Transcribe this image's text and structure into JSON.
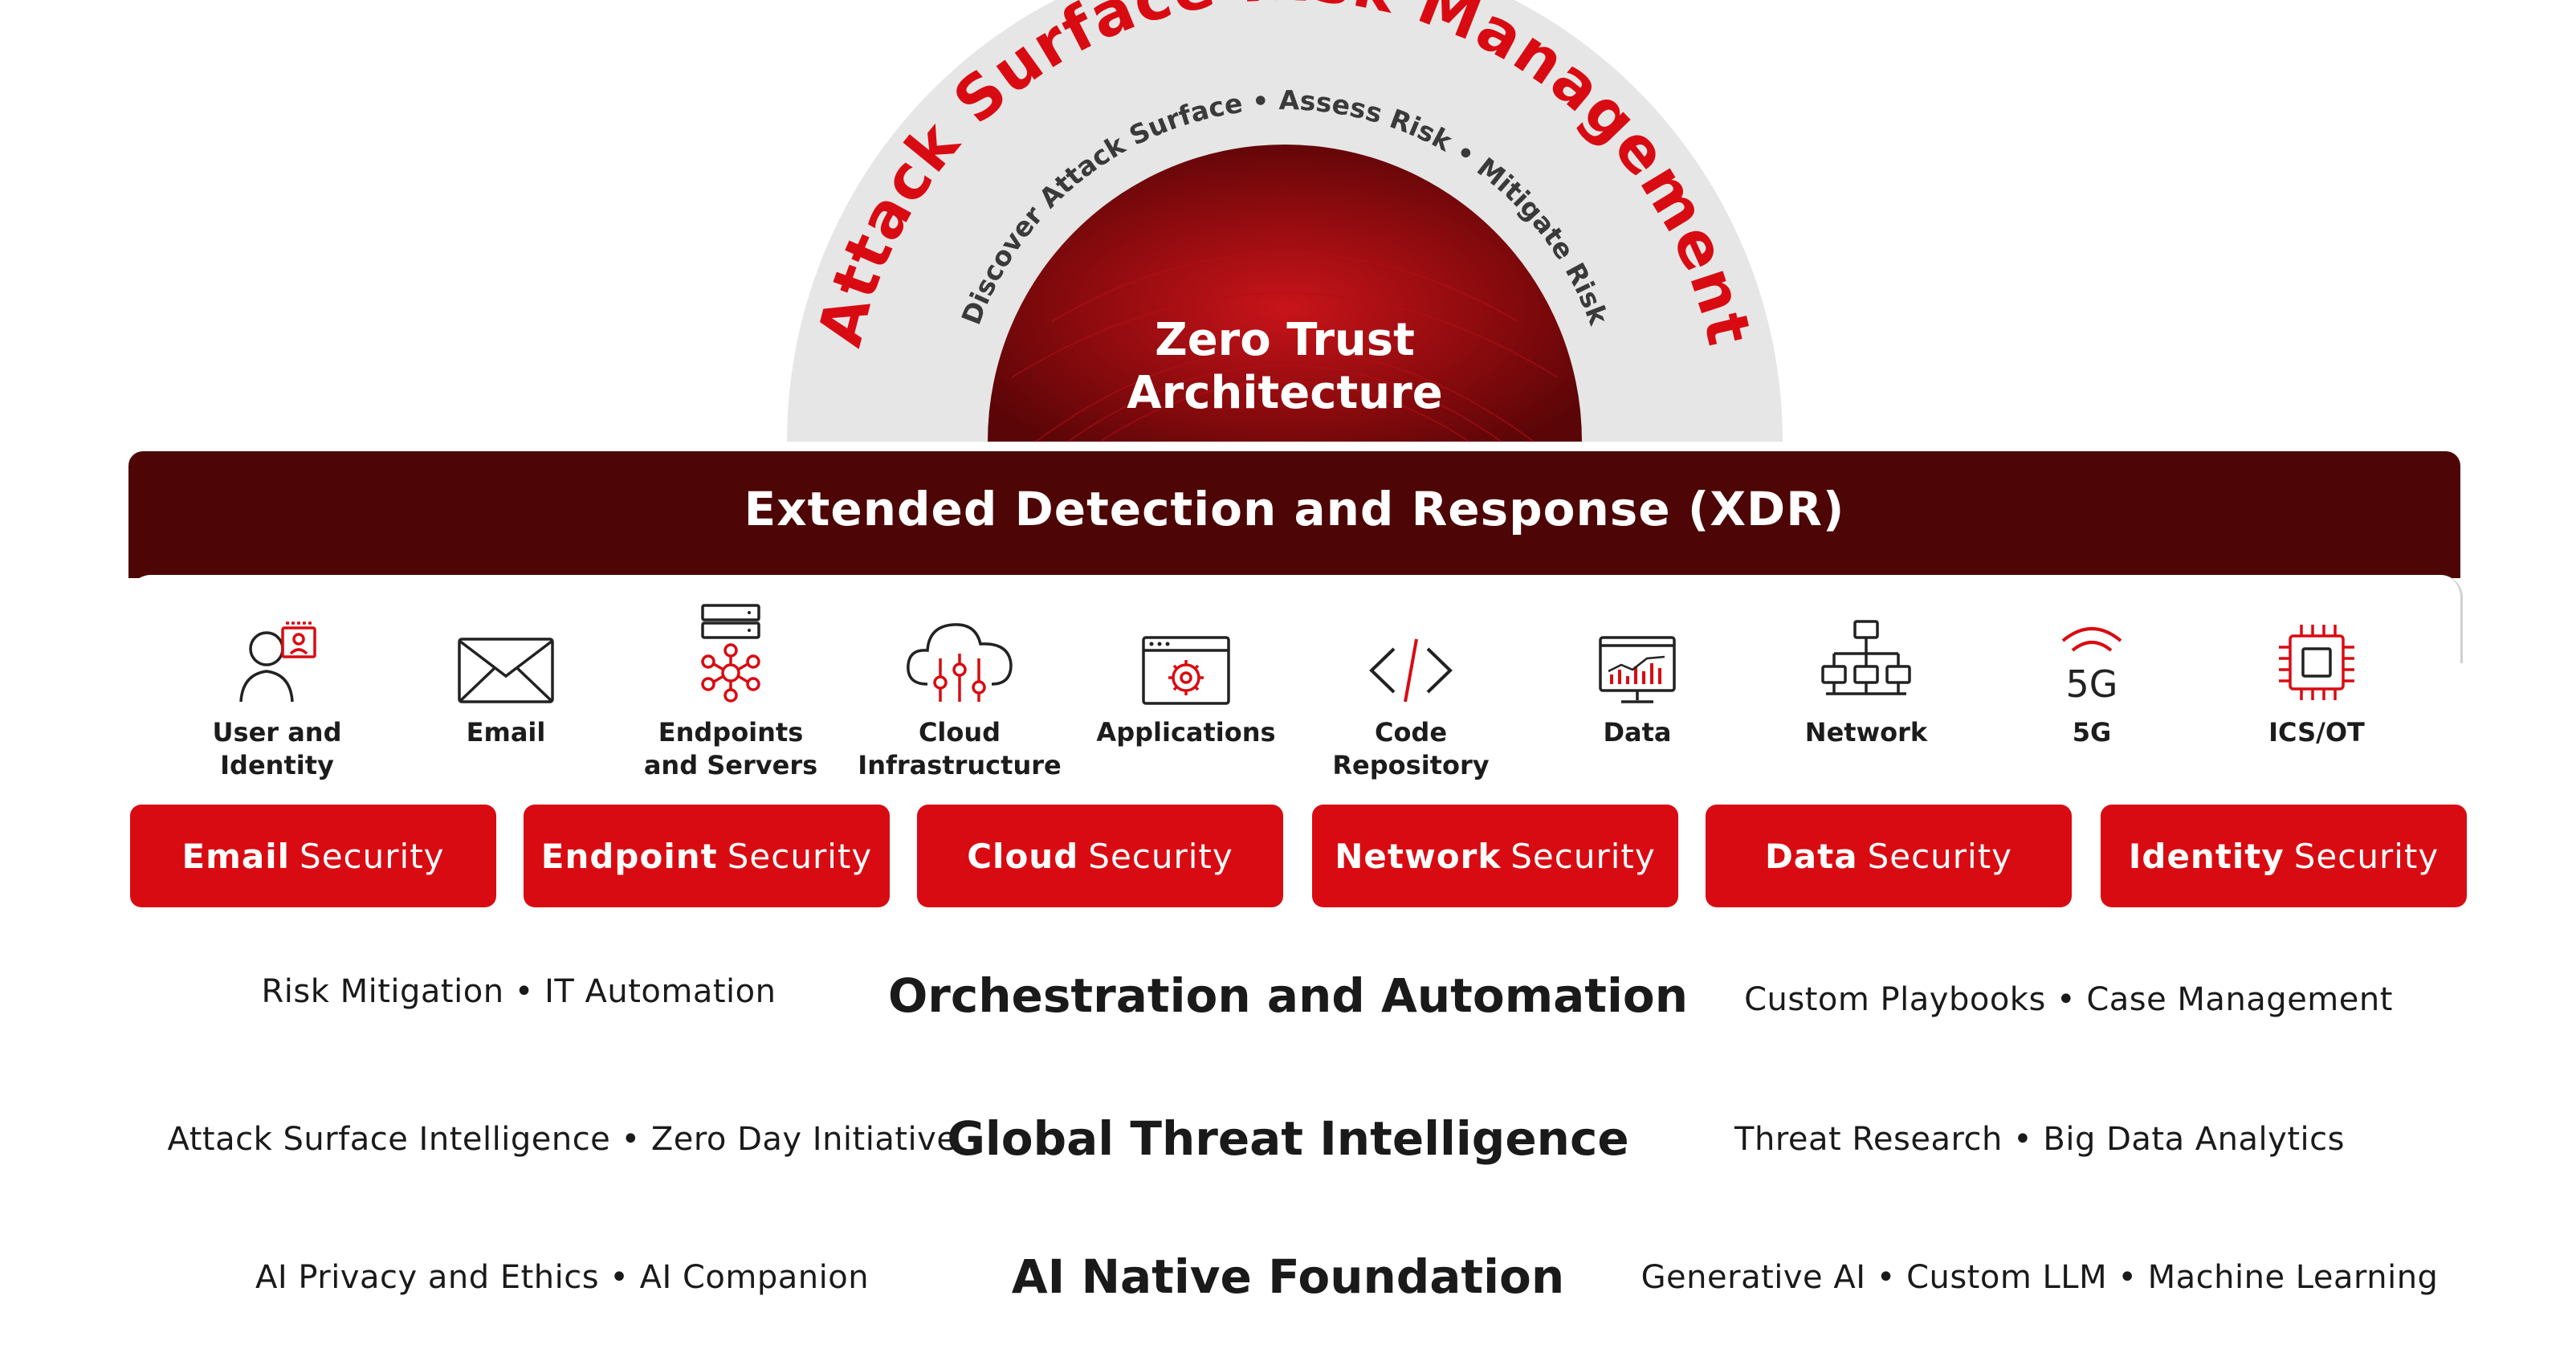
{
  "colors": {
    "red": "#d90b12",
    "dark_red": "#4d0505",
    "grey_arc": "#e6e6e6",
    "text": "#1a1a1a"
  },
  "arc": {
    "title": "Attack Surface Risk Management",
    "steps": [
      "Discover Attack Surface",
      "Assess Risk",
      "Mitigate Risk"
    ]
  },
  "zero_trust": {
    "line1": "Zero Trust",
    "line2": "Architecture"
  },
  "xdr": {
    "title": "Extended Detection and Response (XDR)"
  },
  "assets": [
    {
      "icon": "user-identity-icon",
      "line1": "User and",
      "line2": "Identity"
    },
    {
      "icon": "email-icon",
      "line1": "Email",
      "line2": ""
    },
    {
      "icon": "servers-icon",
      "line1": "Endpoints",
      "line2": "and Servers"
    },
    {
      "icon": "cloud-icon",
      "line1": "Cloud",
      "line2": "Infrastructure"
    },
    {
      "icon": "applications-icon",
      "line1": "Applications",
      "line2": ""
    },
    {
      "icon": "code-icon",
      "line1": "Code",
      "line2": "Repository"
    },
    {
      "icon": "data-icon",
      "line1": "Data",
      "line2": ""
    },
    {
      "icon": "network-icon",
      "line1": "Network",
      "line2": ""
    },
    {
      "icon": "fiveg-icon",
      "line1": "5G",
      "line2": "",
      "icon_text": "5G"
    },
    {
      "icon": "chip-icon",
      "line1": "ICS/OT",
      "line2": ""
    }
  ],
  "security": [
    {
      "bold": "Email",
      "rest": "Security"
    },
    {
      "bold": "Endpoint",
      "rest": "Security"
    },
    {
      "bold": "Cloud",
      "rest": "Security"
    },
    {
      "bold": "Network",
      "rest": "Security"
    },
    {
      "bold": "Data",
      "rest": "Security"
    },
    {
      "bold": "Identity",
      "rest": "Security"
    }
  ],
  "rows": [
    {
      "left": "Risk Mitigation • IT Automation",
      "center": "Orchestration and Automation",
      "right": "Custom Playbooks • Case Management"
    },
    {
      "left": "Attack Surface Intelligence • Zero Day Initiative",
      "center": "Global Threat Intelligence",
      "right": "Threat Research • Big Data Analytics"
    },
    {
      "left": "AI Privacy and Ethics • AI Companion",
      "center": "AI Native Foundation",
      "right": "Generative AI • Custom LLM • Machine Learning"
    }
  ]
}
